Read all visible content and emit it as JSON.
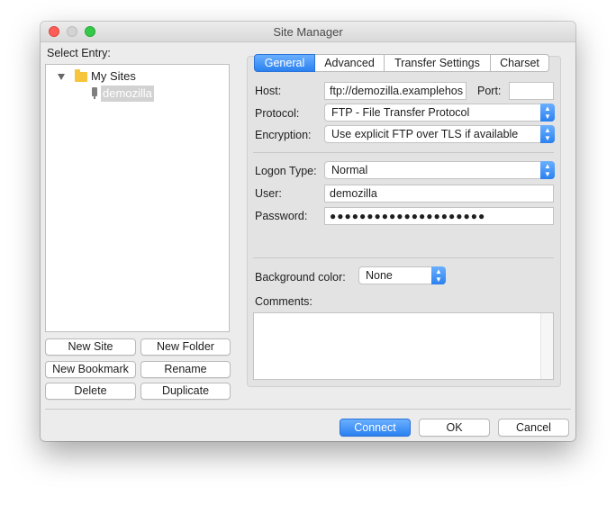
{
  "window": {
    "title": "Site Manager"
  },
  "select_entry_label": "Select Entry:",
  "tree": {
    "folder": "My Sites",
    "site": "demozilla"
  },
  "left_buttons": {
    "new_site": "New Site",
    "new_folder": "New Folder",
    "new_bookmark": "New Bookmark",
    "rename": "Rename",
    "delete": "Delete",
    "duplicate": "Duplicate"
  },
  "tabs": [
    "General",
    "Advanced",
    "Transfer Settings",
    "Charset"
  ],
  "general": {
    "host_label": "Host:",
    "host_value": "ftp://demozilla.examplehos",
    "port_label": "Port:",
    "port_value": "",
    "protocol_label": "Protocol:",
    "protocol_value": "FTP - File Transfer Protocol",
    "encryption_label": "Encryption:",
    "encryption_value": "Use explicit FTP over TLS if available",
    "logon_type_label": "Logon Type:",
    "logon_type_value": "Normal",
    "user_label": "User:",
    "user_value": "demozilla",
    "password_label": "Password:",
    "password_value": "●●●●●●●●●●●●●●●●●●●●●",
    "background_color_label": "Background color:",
    "background_color_value": "None",
    "comments_label": "Comments:",
    "comments_value": ""
  },
  "footer": {
    "connect": "Connect",
    "ok": "OK",
    "cancel": "Cancel"
  },
  "colors": {
    "accent": "#2a81f0",
    "window_bg": "#ececec",
    "folder": "#f6c53c"
  },
  "icons": {
    "folder": "folder-icon",
    "site": "server-icon",
    "expand": "disclosure-triangle-icon",
    "stepper": "up-down-stepper-icon"
  }
}
